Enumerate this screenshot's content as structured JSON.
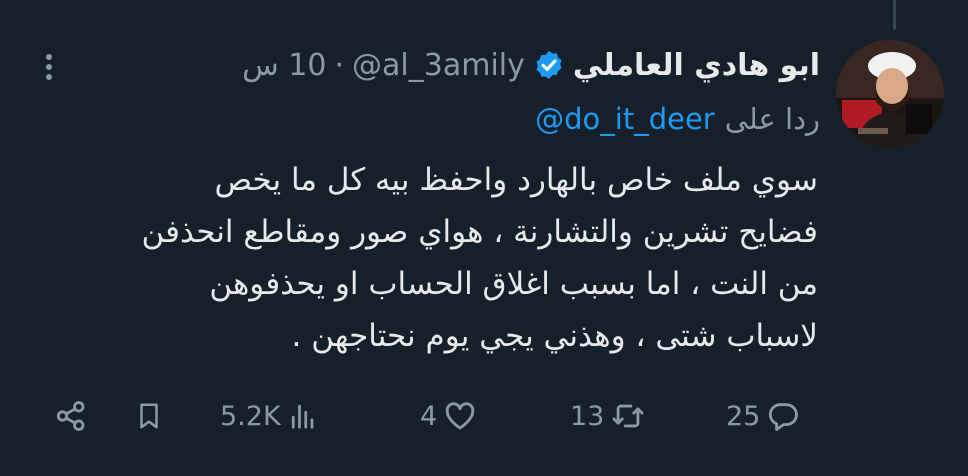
{
  "tweet": {
    "author_name": "ابو هادي العاملي",
    "handle": "@al_3amily",
    "separator": "·",
    "time": "10 س",
    "reply_prefix": "ردا على",
    "reply_handle": "@do_it_deer",
    "text_lines": [
      "سوي ملف خاص بالهارد واحفظ بيه كل ما يخص",
      "فضايح تشرين والتشارنة ، هواي صور ومقاطع انحذفن",
      "من النت ، اما بسبب اغلاق الحساب او يحذفوهن",
      "لاسباب شتى ،  وهذني يجي يوم نحتاجهن ."
    ]
  },
  "actions": {
    "replies": "25",
    "retweets": "13",
    "likes": "4",
    "views": "5.2K"
  },
  "icons": {
    "verified": "verified-badge-icon",
    "more": "more-dots-icon",
    "reply": "speech-bubble-icon",
    "retweet": "retweet-arrows-icon",
    "like": "heart-icon",
    "views": "bar-chart-icon",
    "bookmark": "bookmark-icon",
    "share": "share-icon"
  },
  "colors": {
    "background": "#15202b",
    "primary_text": "#e7e9ea",
    "secondary_text": "#8b98a5",
    "link": "#1d9bf0"
  }
}
